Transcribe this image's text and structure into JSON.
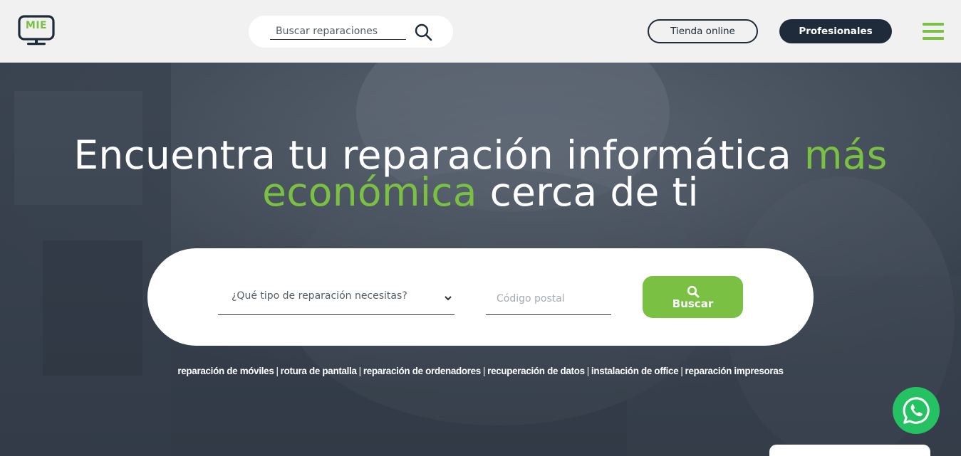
{
  "header": {
    "logo_text": "MIE",
    "search": {
      "placeholder": "Buscar reparaciones",
      "value": ""
    },
    "tienda_label": "Tienda online",
    "profesionales_label": "Profesionales"
  },
  "hero": {
    "title_part1": "Encuentra tu reparación informática ",
    "title_green1": "más",
    "title_green2": "económica",
    "title_part2": " cerca de ti",
    "repair_select": {
      "selected": "¿Qué tipo de reparación necesitas?"
    },
    "postal": {
      "placeholder": "Código postal",
      "value": ""
    },
    "buscar_label": "Buscar",
    "quick_links": [
      "reparación de móviles",
      "rotura de pantalla",
      "reparación de ordenadores",
      "recuperación de datos",
      "instalación de office",
      "reparación impresoras"
    ],
    "separator": "|"
  },
  "colors": {
    "brand_green": "#7ac143",
    "navy": "#1f2a3a",
    "header_bg": "#f1f1f1",
    "whatsapp": "#25c263"
  },
  "icons": [
    "monitor-logo-icon",
    "search-icon",
    "hamburger-menu-icon",
    "chevron-down-icon",
    "whatsapp-icon"
  ]
}
